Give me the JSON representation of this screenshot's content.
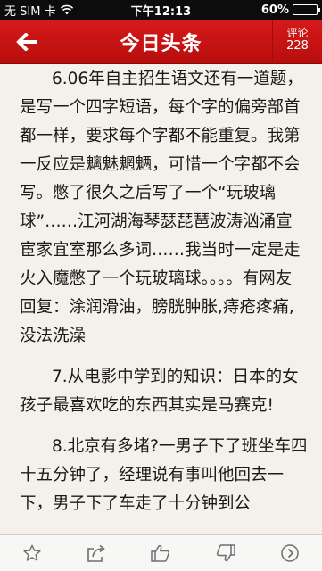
{
  "status_bar": {
    "carrier": "无 SIM 卡",
    "time": "下午12:13",
    "battery_percent": "60%",
    "battery_level": 0.6
  },
  "nav": {
    "title": "今日头条",
    "comment_label": "评论",
    "comment_count": "228",
    "icons": {
      "back": "back-arrow-icon"
    },
    "accent_color": "#c81414"
  },
  "article": {
    "paragraphs": [
      "6.06年自主招生语文还有一道题，是写一个四字短语，每个字的偏旁部首都一样，要求每个字都不能重复。我第一反应是魑魅魍魉，可惜一个字都不会写。憋了很久之后写了一个“玩玻璃球”……江河湖海琴瑟琵琶波涛汹涌宣宦家宜室那么多词……我当时一定是走火入魔憋了一个玩玻璃球。。。。有网友回复：涂润滑油，膀胱肿胀,痔疮疼痛,没法洗澡",
      "7.从电影中学到的知识：日本的女孩子最喜欢吃的东西其实是马赛克!",
      "8.北京有多堵?一男子下了班坐车四十五分钟了，经理说有事叫他回去一下，男子下了车走了十分钟到公"
    ]
  },
  "toolbar": {
    "icons": [
      "star-icon",
      "share-icon",
      "thumbs-up-icon",
      "thumbs-down-icon",
      "next-icon"
    ]
  }
}
